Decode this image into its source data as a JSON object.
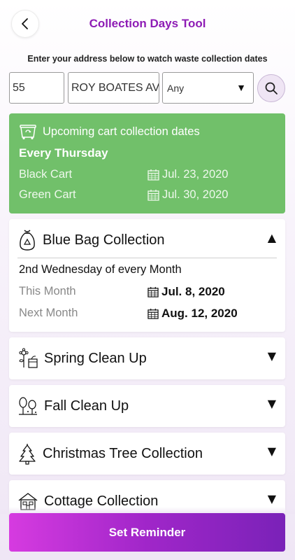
{
  "header": {
    "title": "Collection Days Tool",
    "back_icon": "chevron-left-icon"
  },
  "address": {
    "instructions": "Enter your address below to watch waste collection dates",
    "street_number": "55",
    "street_name": "ROY BOATES AVE",
    "unit_select": "Any",
    "search_icon": "search-icon"
  },
  "upcoming": {
    "heading": "Upcoming cart collection dates",
    "frequency": "Every Thursday",
    "color": "#71c06a",
    "rows": [
      {
        "label": "Black Cart",
        "date": "Jul. 23, 2020"
      },
      {
        "label": "Green Cart",
        "date": "Jul. 30, 2020"
      }
    ]
  },
  "blue_bag": {
    "title": "Blue Bag Collection",
    "expanded": true,
    "schedule": "2nd Wednesday of every Month",
    "rows": [
      {
        "label": "This Month",
        "date": "Jul. 8, 2020"
      },
      {
        "label": "Next Month",
        "date": "Aug. 12, 2020"
      }
    ]
  },
  "sections": [
    {
      "title": "Spring Clean Up",
      "icon": "flowers-icon"
    },
    {
      "title": "Fall Clean Up",
      "icon": "trees-icon"
    },
    {
      "title": "Christmas Tree Collection",
      "icon": "christmas-tree-icon"
    },
    {
      "title": "Cottage Collection",
      "icon": "cottage-icon"
    }
  ],
  "footer": {
    "reminder_label": "Set Reminder"
  }
}
